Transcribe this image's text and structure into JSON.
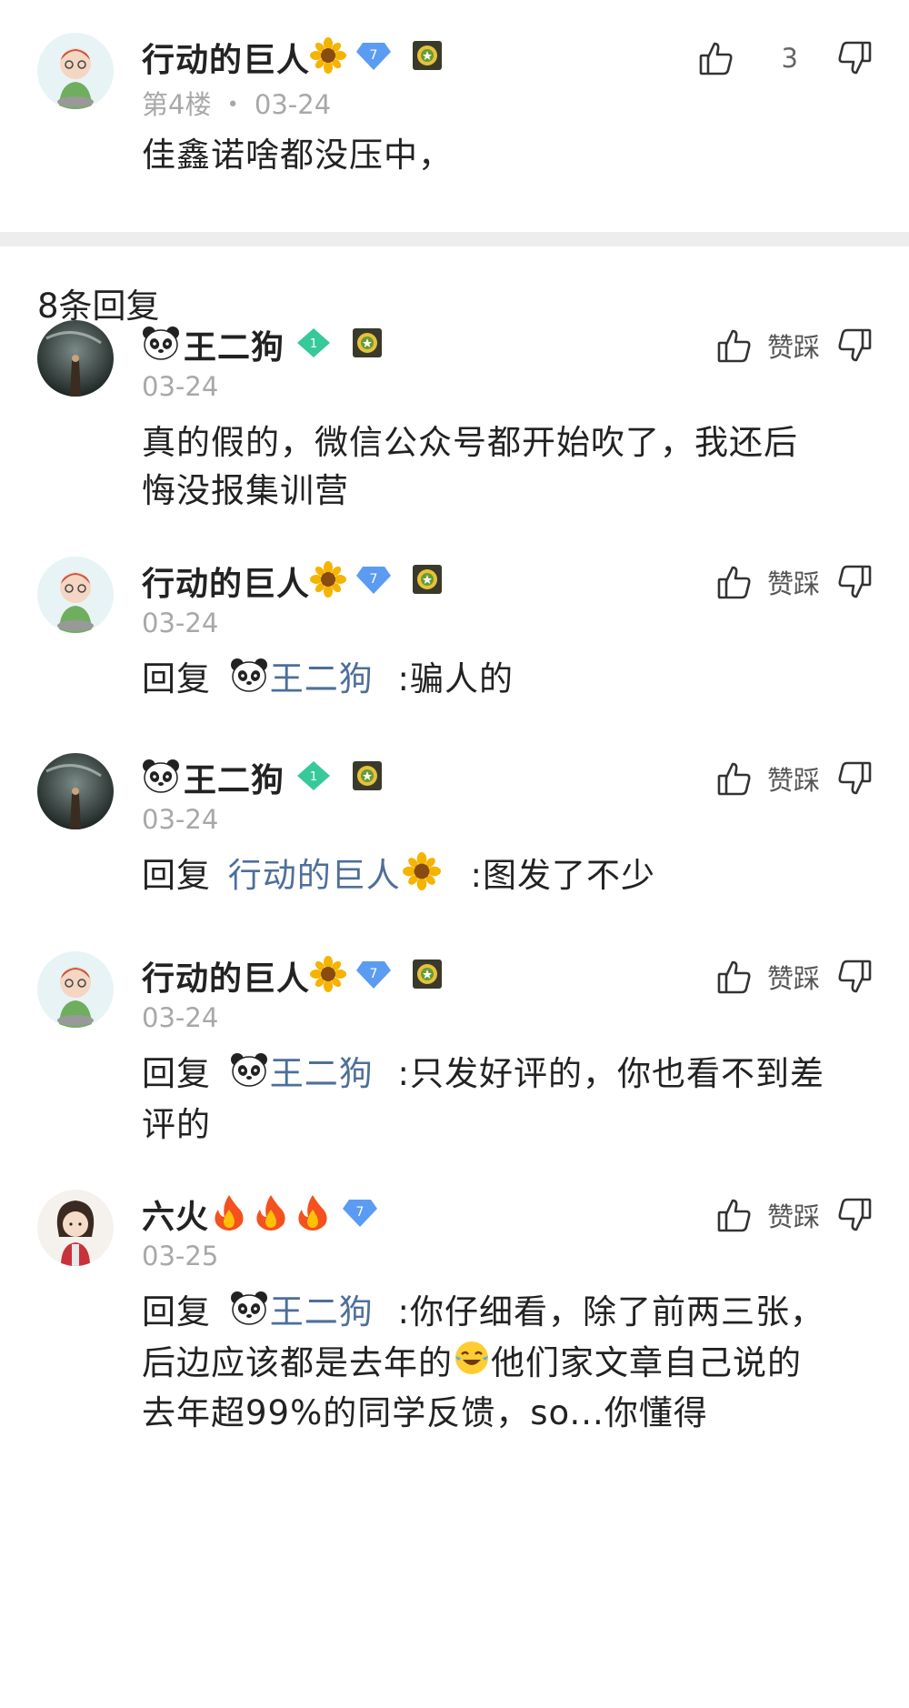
{
  "main_comment": {
    "username": "行动的巨人",
    "level": "7",
    "floor": "第4楼",
    "dot": "•",
    "date": "03-24",
    "text": "佳鑫诺啥都没压中，",
    "like_count": "3"
  },
  "replies_header": "8条回复",
  "action_label": "赞踩",
  "replies": [
    {
      "username": "王二狗",
      "level": "1",
      "date": "03-24",
      "text_lines": [
        "真的假的，微信公众号都开始吹了，我还后",
        "悔没报集训营"
      ]
    },
    {
      "username": "行动的巨人",
      "level": "7",
      "date": "03-24",
      "reply_word": "回复",
      "mention": "王二狗",
      "text": ":骗人的"
    },
    {
      "username": "王二狗",
      "level": "1",
      "date": "03-24",
      "reply_word": "回复",
      "mention": "行动的巨人",
      "text": ":图发了不少"
    },
    {
      "username": "行动的巨人",
      "level": "7",
      "date": "03-24",
      "reply_word": "回复",
      "mention": "王二狗",
      "text": ":只发好评的，你也看不到差",
      "text_line2": "评的"
    },
    {
      "username": "六火",
      "level": "7",
      "date": "03-25",
      "reply_word": "回复",
      "mention": "王二狗",
      "text": ":你仔细看，除了前两三张，",
      "line2_a": "后边应该都是去年的",
      "line2_b": "他们家文章自己说的",
      "line3": "去年超99%的同学反馈，so...你懂得"
    }
  ],
  "colors": {
    "blue_badge": "#5b9cf2",
    "green_badge": "#37c99a",
    "mention": "#4d6f9a",
    "meta": "#a8a8a8",
    "divider": "#ededed"
  },
  "icons": [
    "thumb-up-icon",
    "thumb-down-icon",
    "sunflower-icon",
    "panda-icon",
    "fire-icon",
    "diamond-level-badge",
    "honor-medal-icon",
    "crying-laughing-icon"
  ]
}
